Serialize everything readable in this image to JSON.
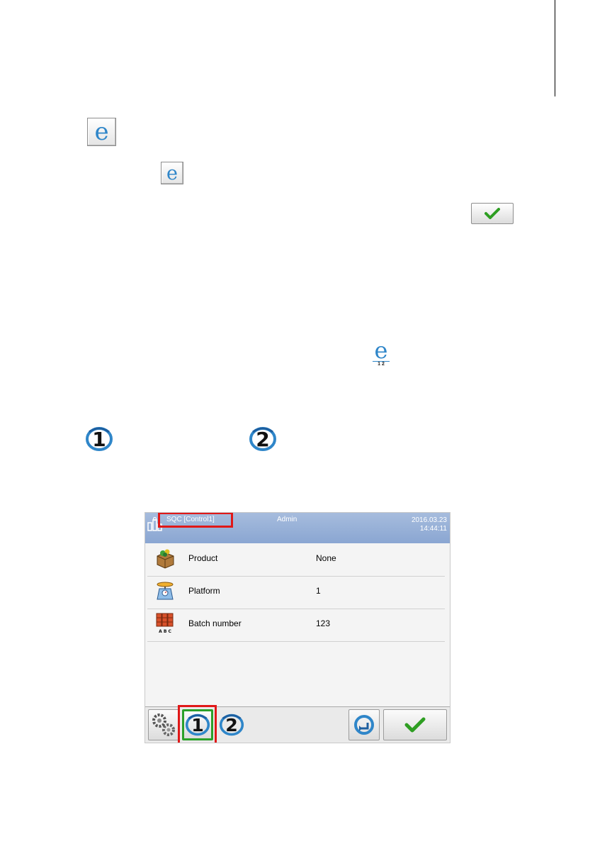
{
  "icons": {
    "e_glyph": "e",
    "e12_glyph": "e",
    "e12_sub": "1 2",
    "one_glyph": "1",
    "two_glyph": "2"
  },
  "screenshot": {
    "header": {
      "mode_title": "SQC [Control1]",
      "user": "Admin",
      "date": "2016.03.23",
      "time": "14:44:11"
    },
    "rows": [
      {
        "label": "Product",
        "value": "None",
        "icon": "product-box-icon"
      },
      {
        "label": "Platform",
        "value": "1",
        "icon": "platform-scale-icon"
      },
      {
        "label": "Batch number",
        "value": "123",
        "icon": "batch-abc-icon"
      }
    ],
    "batch_icon_text": "A B C",
    "footer": {
      "buttons": [
        "settings-gears-icon",
        "control-1-icon",
        "control-2-icon",
        "exit-icon",
        "confirm-check-icon"
      ]
    }
  },
  "colors": {
    "header_blue": "#8aa6d2",
    "highlight_red": "#e01818",
    "active_green": "#2aa02a",
    "check_green": "#2e9e22",
    "icon_blue": "#2f86c9"
  }
}
